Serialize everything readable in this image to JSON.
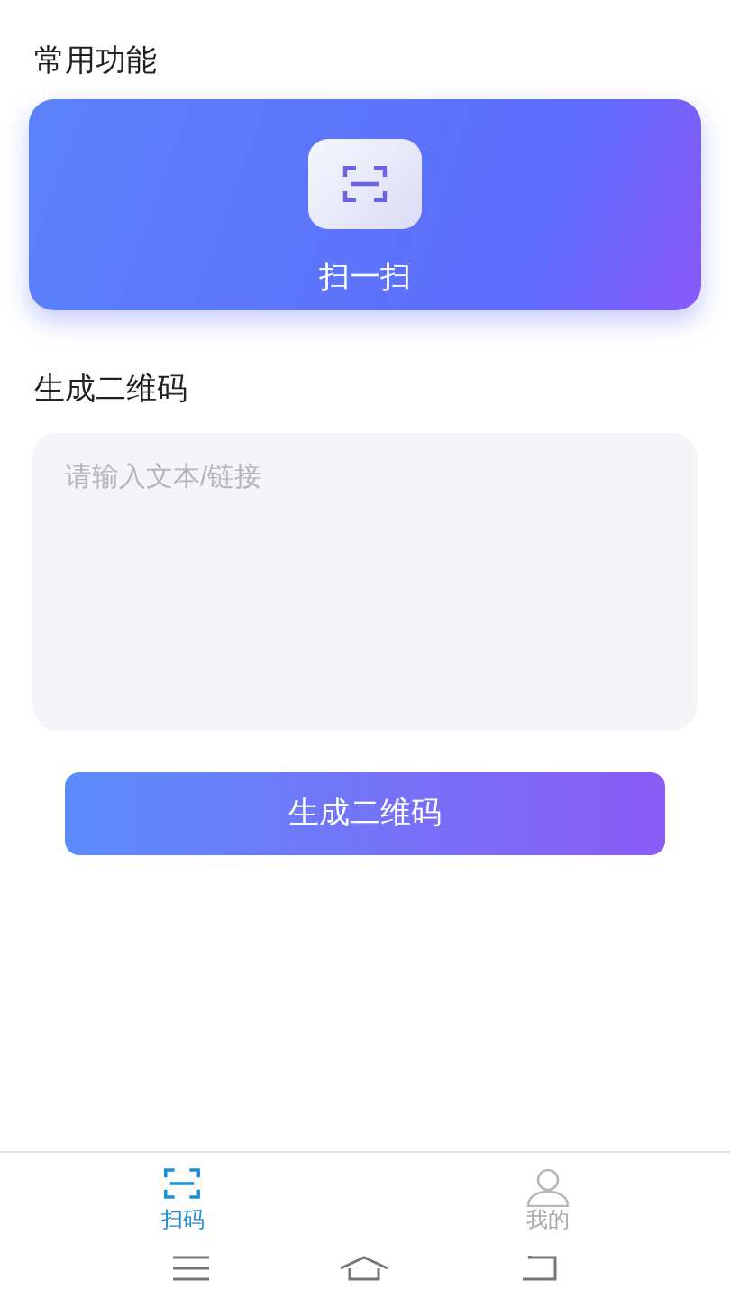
{
  "common_section": {
    "title": "常用功能",
    "scan_card": {
      "label": "扫一扫"
    }
  },
  "generate_section": {
    "title": "生成二维码",
    "input": {
      "placeholder": "请输入文本/链接"
    },
    "button": "生成二维码"
  },
  "tabs": [
    {
      "label": "扫码",
      "kind": "scan",
      "selected": true
    },
    {
      "label": "我的",
      "kind": "profile",
      "selected": false
    }
  ]
}
